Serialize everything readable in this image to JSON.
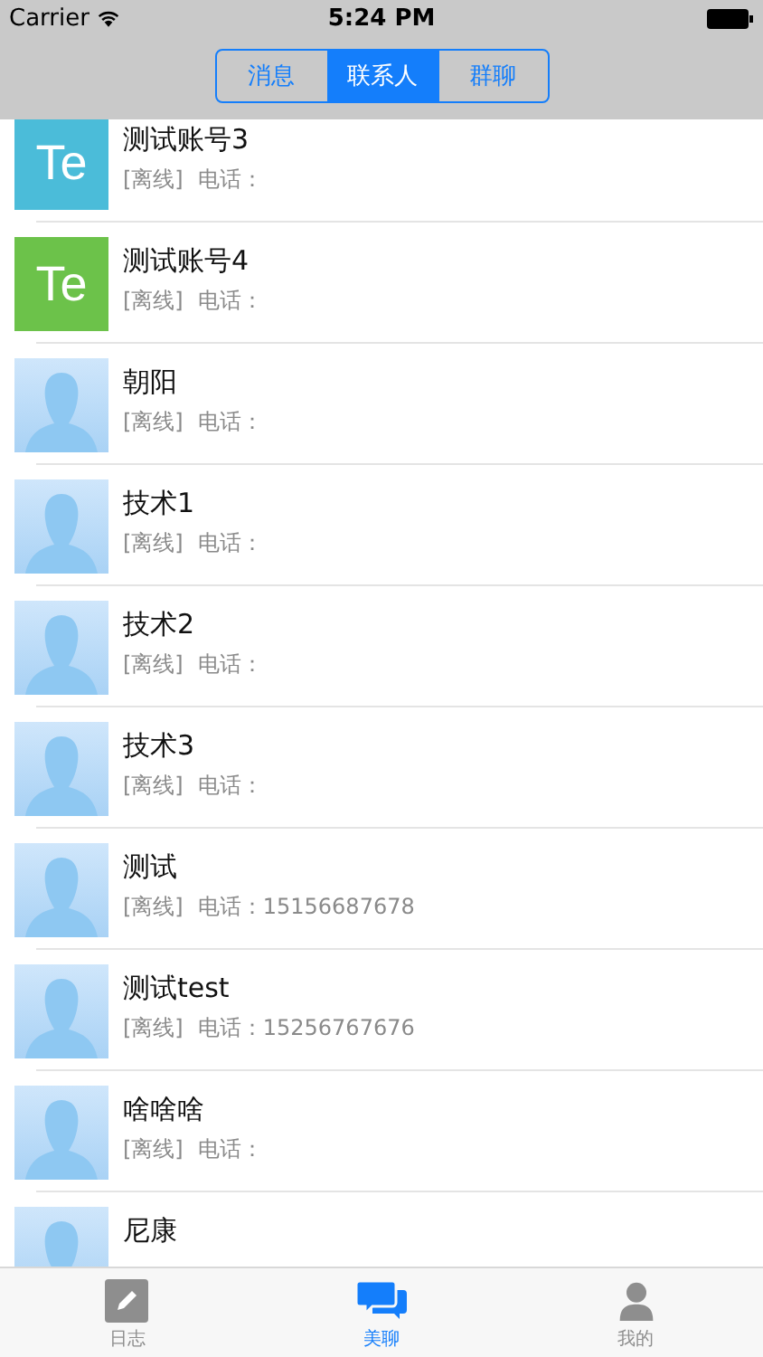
{
  "status_bar": {
    "carrier": "Carrier",
    "time": "5:24 PM"
  },
  "segments": [
    {
      "label": "消息",
      "selected": false
    },
    {
      "label": "联系人",
      "selected": true
    },
    {
      "label": "群聊",
      "selected": false
    }
  ],
  "contacts": [
    {
      "name": "测试账号3",
      "status": "[离线]",
      "phone": "电话：",
      "avatar": {
        "kind": "letters",
        "text": "Te",
        "color": "#4bbcd9"
      }
    },
    {
      "name": "测试账号4",
      "status": "[离线]",
      "phone": "电话：",
      "avatar": {
        "kind": "letters",
        "text": "Te",
        "color": "#6cc24a"
      }
    },
    {
      "name": "朝阳",
      "status": "[离线]",
      "phone": "电话：",
      "avatar": {
        "kind": "silhouette"
      }
    },
    {
      "name": "技术1",
      "status": "[离线]",
      "phone": "电话：",
      "avatar": {
        "kind": "silhouette"
      }
    },
    {
      "name": "技术2",
      "status": "[离线]",
      "phone": "电话：",
      "avatar": {
        "kind": "silhouette"
      }
    },
    {
      "name": "技术3",
      "status": "[离线]",
      "phone": "电话：",
      "avatar": {
        "kind": "silhouette"
      }
    },
    {
      "name": "测试",
      "status": "[离线]",
      "phone": "电话：15156687678",
      "avatar": {
        "kind": "silhouette"
      }
    },
    {
      "name": "测试test",
      "status": "[离线]",
      "phone": "电话：15256767676",
      "avatar": {
        "kind": "silhouette"
      }
    },
    {
      "name": "啥啥啥",
      "status": "[离线]",
      "phone": "电话：",
      "avatar": {
        "kind": "silhouette"
      }
    },
    {
      "name": "尼康",
      "avatar": {
        "kind": "silhouette"
      }
    }
  ],
  "tab_bar": [
    {
      "label": "日志",
      "kind": "pencil",
      "selected": false
    },
    {
      "label": "美聊",
      "kind": "chat",
      "selected": true
    },
    {
      "label": "我的",
      "kind": "person",
      "selected": false
    }
  ]
}
